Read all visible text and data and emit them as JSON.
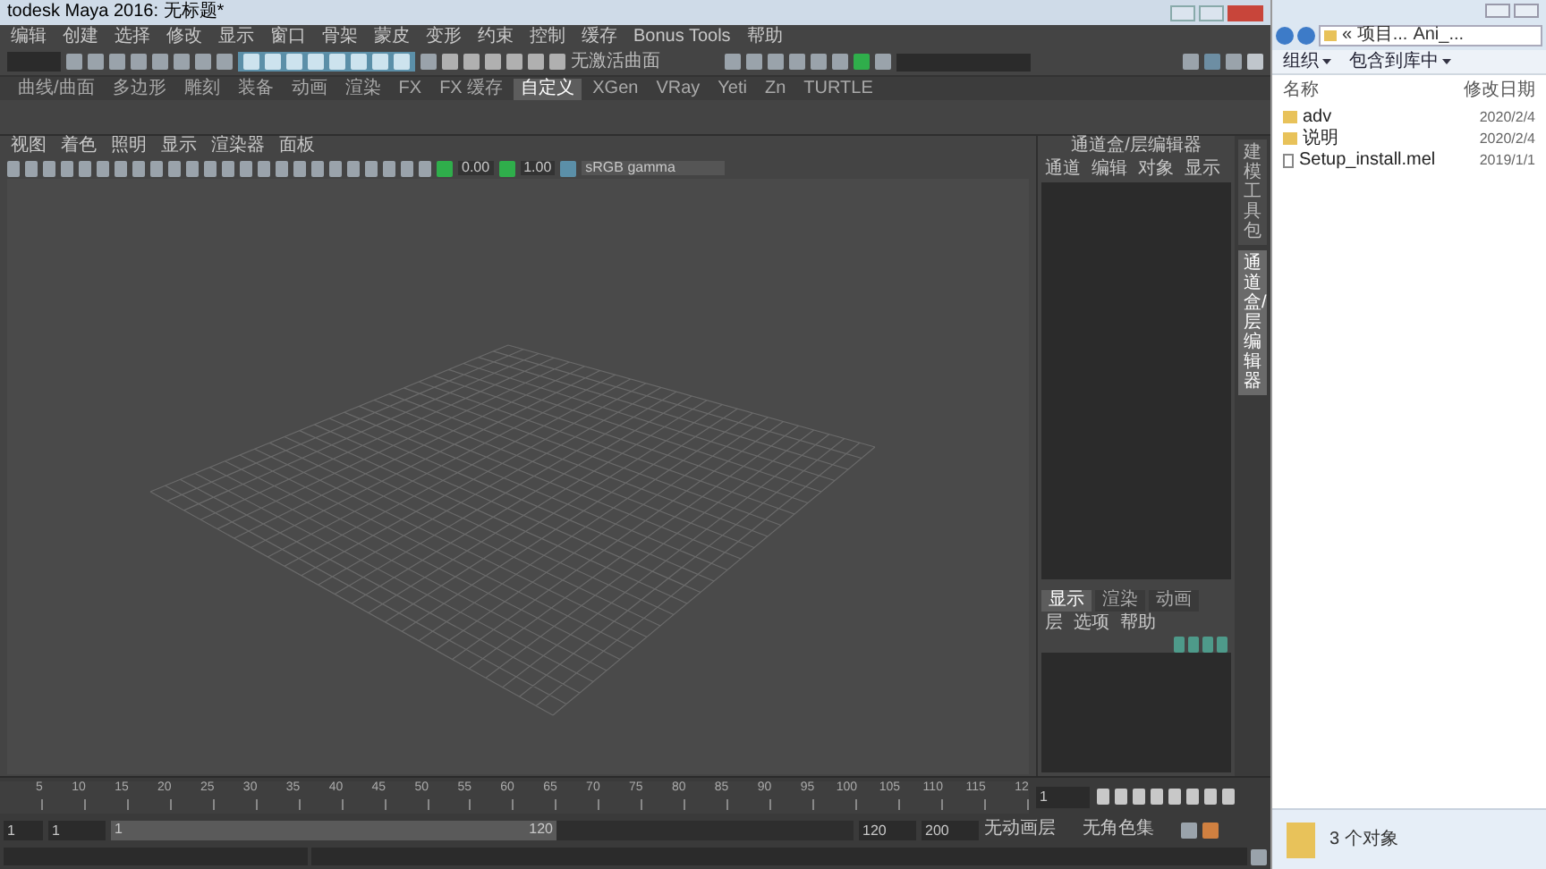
{
  "maya": {
    "title": "todesk Maya 2016: 无标题*",
    "menu": [
      "编辑",
      "创建",
      "选择",
      "修改",
      "显示",
      "窗口",
      "骨架",
      "蒙皮",
      "变形",
      "约束",
      "控制",
      "缓存",
      "Bonus Tools",
      "帮助"
    ],
    "status_line": {
      "surface_field": "无激活曲面"
    },
    "shelf_tabs": [
      {
        "label": "曲线/曲面",
        "selected": false
      },
      {
        "label": "多边形",
        "selected": false
      },
      {
        "label": "雕刻",
        "selected": false
      },
      {
        "label": "装备",
        "selected": false
      },
      {
        "label": "动画",
        "selected": false
      },
      {
        "label": "渲染",
        "selected": false
      },
      {
        "label": "FX",
        "selected": false
      },
      {
        "label": "FX 缓存",
        "selected": false
      },
      {
        "label": "自定义",
        "selected": true
      },
      {
        "label": "XGen",
        "selected": false
      },
      {
        "label": "VRay",
        "selected": false
      },
      {
        "label": "Yeti",
        "selected": false
      },
      {
        "label": "Zn",
        "selected": false
      },
      {
        "label": "TURTLE",
        "selected": false
      }
    ],
    "panel_menu": [
      "视图",
      "着色",
      "照明",
      "显示",
      "渲染器",
      "面板"
    ],
    "panel_toolbar": {
      "exposure": "0.00",
      "gamma": "1.00",
      "color_space": "sRGB gamma"
    },
    "channel_box": {
      "title": "通道盒/层编辑器",
      "menu": [
        "通道",
        "编辑",
        "对象",
        "显示"
      ]
    },
    "side_tabs": [
      {
        "label": "建模工具包",
        "selected": false
      },
      {
        "label": "通道盒/层编辑器",
        "selected": true
      }
    ],
    "layer_editor": {
      "tabs": [
        {
          "label": "显示",
          "selected": true
        },
        {
          "label": "渲染",
          "selected": false
        },
        {
          "label": "动画",
          "selected": false
        }
      ],
      "menu": [
        "层",
        "选项",
        "帮助"
      ]
    },
    "timeline": {
      "ticks": [
        "5",
        "10",
        "15",
        "20",
        "25",
        "30",
        "35",
        "40",
        "45",
        "50",
        "55",
        "60",
        "65",
        "70",
        "75",
        "80",
        "85",
        "90",
        "95",
        "100",
        "105",
        "110",
        "115",
        "12"
      ],
      "current_frame": "1"
    },
    "range": {
      "start": "1",
      "range_start": "1",
      "slider_start_label": "1",
      "slider_end_label": "120",
      "level": 0.6,
      "end": "120",
      "max": "200",
      "anim_layer": "无动画层",
      "character_set": "无角色集"
    }
  },
  "explorer": {
    "breadcrumb": [
      "« 项目...",
      "Ani_..."
    ],
    "toolbar": [
      "组织",
      "包含到库中"
    ],
    "columns": [
      "名称",
      "修改日期"
    ],
    "rows": [
      {
        "kind": "folder",
        "name": "adv",
        "date": "2020/2/4"
      },
      {
        "kind": "folder",
        "name": "说明",
        "date": "2020/2/4"
      },
      {
        "kind": "file",
        "name": "Setup_install.mel",
        "date": "2019/1/1"
      }
    ],
    "status": "3 个对象"
  }
}
